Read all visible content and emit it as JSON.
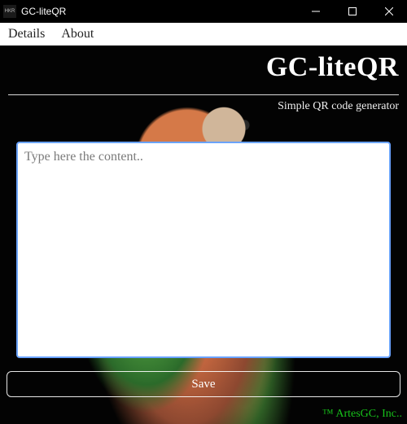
{
  "window": {
    "title": "GC-liteQR",
    "icon_label": "HKR"
  },
  "menubar": {
    "items": [
      "Details",
      "About"
    ]
  },
  "header": {
    "title": "GC-liteQR",
    "subtitle": "Simple QR code generator"
  },
  "main": {
    "content_value": "",
    "content_placeholder": "Type here the content..",
    "save_label": "Save"
  },
  "footer": {
    "trademark": "™ ArtesGC, Inc.."
  },
  "colors": {
    "accent": "#17c21a",
    "titlebar": "#000000",
    "focus_border": "#6aa3ff"
  }
}
